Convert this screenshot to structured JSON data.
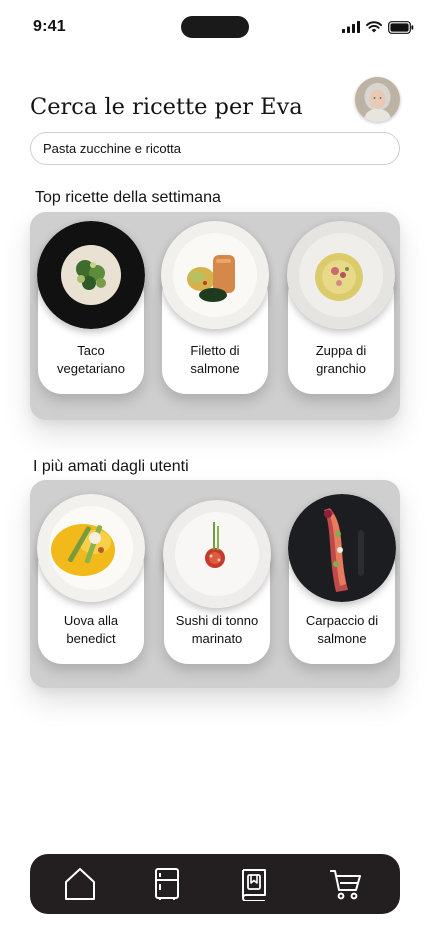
{
  "status_bar": {
    "time": "9:41",
    "icons": [
      "signal-icon",
      "wifi-icon",
      "battery-icon"
    ]
  },
  "header": {
    "title": "Cerca le ricette per Eva",
    "avatar_icon": "user-avatar"
  },
  "search": {
    "value": "Pasta zucchine e ricotta"
  },
  "sections": [
    {
      "title": "Top ricette della settimana",
      "recipes": [
        {
          "label": "Taco\nvegetariano",
          "plate": "black-plate-icon"
        },
        {
          "label": "Filetto di\nsalmone",
          "plate": "white-plate-icon"
        },
        {
          "label": "Zuppa di\ngranchio",
          "plate": "white-plate-icon"
        }
      ]
    },
    {
      "title": "I più amati dagli utenti",
      "recipes": [
        {
          "label": "Uova alla\nbenedict",
          "plate": "white-plate-icon"
        },
        {
          "label": "Sushi di tonno\nmarinato",
          "plate": "white-plate-icon"
        },
        {
          "label": "Carpaccio di\nsalmone",
          "plate": "black-plate-icon"
        }
      ]
    }
  ],
  "bottom_nav": {
    "items": [
      "home-icon",
      "fridge-icon",
      "recipe-book-icon",
      "cart-icon"
    ],
    "active": "home-icon"
  },
  "colors": {
    "nav_background": "#231f20",
    "panel_background": "#cfcfcf",
    "nav_icon": "#ffffff"
  }
}
